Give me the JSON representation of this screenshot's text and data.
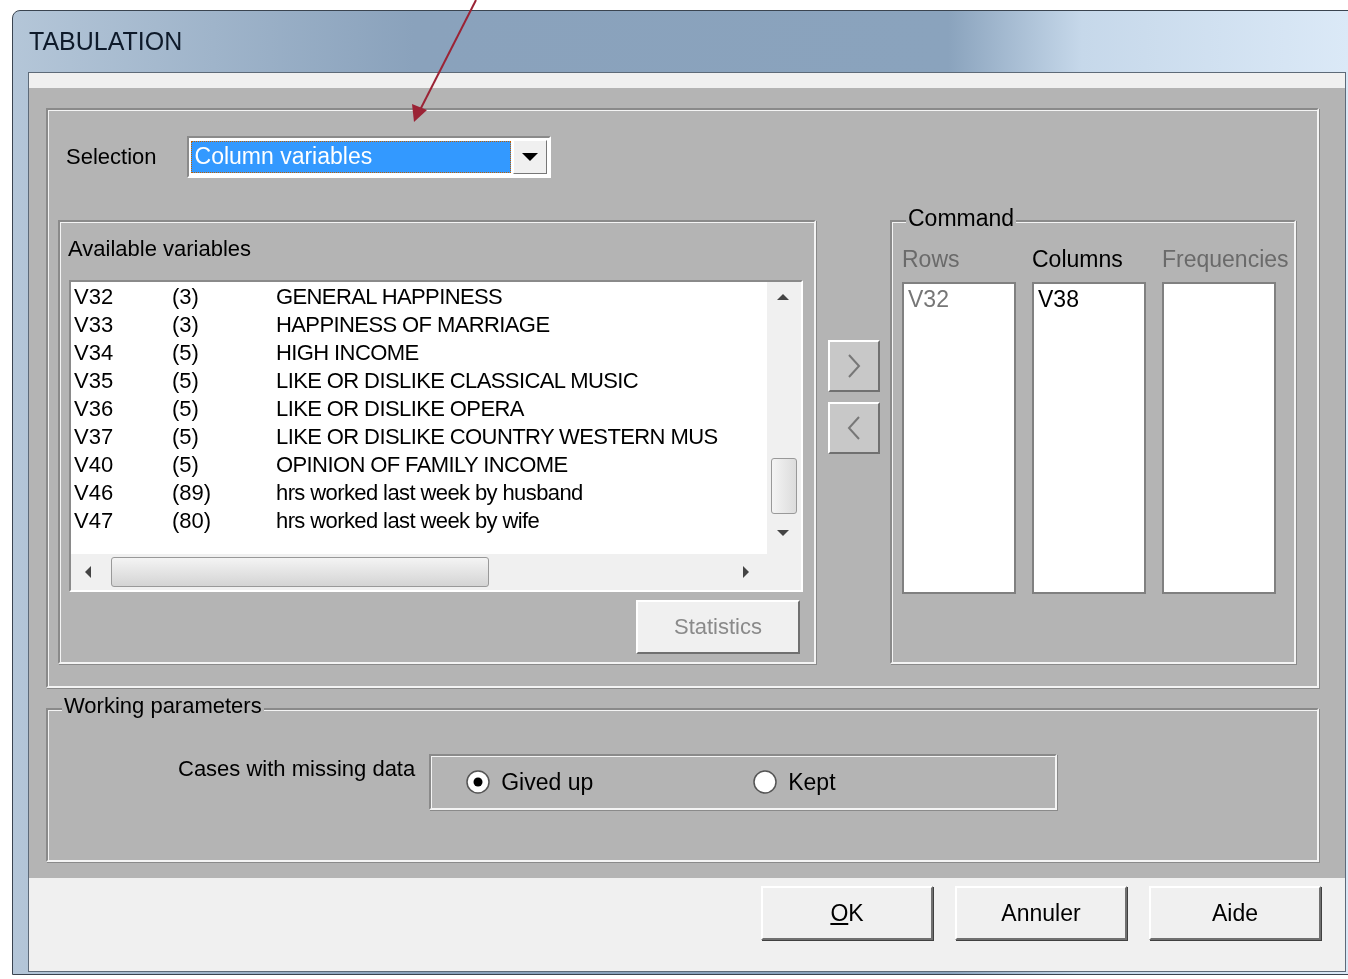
{
  "window": {
    "title": "TABULATION"
  },
  "selection": {
    "label": "Selection",
    "value": "Column variables",
    "focused": true
  },
  "available_variables": {
    "title": "Available variables",
    "rows": [
      {
        "name": "V32",
        "categories": "(3)",
        "label": "GENERAL HAPPINESS"
      },
      {
        "name": "V33",
        "categories": "(3)",
        "label": "HAPPINESS OF MARRIAGE"
      },
      {
        "name": "V34",
        "categories": "(5)",
        "label": "HIGH INCOME"
      },
      {
        "name": "V35",
        "categories": "(5)",
        "label": "LIKE OR DISLIKE CLASSICAL MUSIC"
      },
      {
        "name": "V36",
        "categories": "(5)",
        "label": "LIKE OR DISLIKE OPERA"
      },
      {
        "name": "V37",
        "categories": "(5)",
        "label": "LIKE OR DISLIKE COUNTRY WESTERN MUS"
      },
      {
        "name": "V40",
        "categories": "(5)",
        "label": "OPINION OF FAMILY INCOME"
      },
      {
        "name": "V46",
        "categories": "(89)",
        "label": "hrs worked last week by husband"
      },
      {
        "name": "V47",
        "categories": "(80)",
        "label": "hrs worked last week by wife"
      }
    ],
    "statistics_button": {
      "label": "Statistics",
      "disabled": true
    }
  },
  "command": {
    "title": "Command",
    "lists": [
      {
        "label": "Rows",
        "active": false,
        "items": [
          "V32"
        ]
      },
      {
        "label": "Columns",
        "active": true,
        "items": [
          "V38"
        ]
      },
      {
        "label": "Frequencies",
        "active": false
      }
    ]
  },
  "working_parameters": {
    "title": "Working parameters",
    "missing_data": {
      "label": "Cases with missing data",
      "options": [
        {
          "label": "Gived up",
          "selected": true
        },
        {
          "label": "Kept",
          "selected": false
        }
      ]
    }
  },
  "buttons": [
    {
      "label": "OK",
      "mnemonic": true
    },
    {
      "label": "Annuler",
      "mnemonic": false
    },
    {
      "label": "Aide",
      "mnemonic": false
    }
  ]
}
